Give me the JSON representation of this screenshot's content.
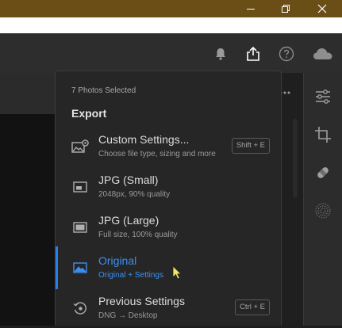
{
  "window": {
    "minimize_label": "minimize",
    "restore_label": "restore",
    "close_label": "close"
  },
  "toolbar": {
    "icons": [
      "bell-icon",
      "share-icon",
      "help-icon",
      "cloud-icon"
    ]
  },
  "export_menu": {
    "selection_count_text": "7 Photos Selected",
    "title": "Export",
    "items": [
      {
        "label": "Custom Settings...",
        "sub": "Choose file type, sizing and more",
        "shortcut": "Shift + E",
        "icon": "image-settings-icon"
      },
      {
        "label": "JPG (Small)",
        "sub": "2048px, 90% quality",
        "shortcut": "",
        "icon": "image-small-icon"
      },
      {
        "label": "JPG (Large)",
        "sub": "Full size, 100% quality",
        "shortcut": "",
        "icon": "image-large-icon"
      },
      {
        "label": "Original",
        "sub": "Original + Settings",
        "shortcut": "",
        "icon": "image-original-icon",
        "active": true
      },
      {
        "label": "Previous Settings",
        "sub": "DNG → Desktop",
        "shortcut": "Ctrl + E",
        "icon": "history-icon"
      }
    ]
  },
  "right_tools": [
    "adjust-sliders-icon",
    "crop-icon",
    "healing-icon",
    "masking-icon"
  ],
  "colors": {
    "accent": "#2680eb",
    "titlebar": "#6b4e16",
    "menu_bg": "#262626"
  }
}
